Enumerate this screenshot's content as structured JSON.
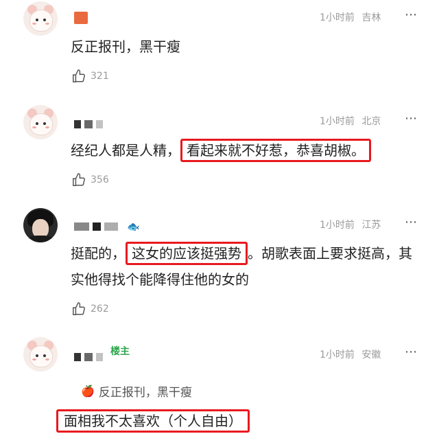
{
  "comments": [
    {
      "name_masked": "",
      "time": "1小时前",
      "location": "吉林",
      "text_pre": "反正报刊，黑干瘦",
      "text_hl": "",
      "text_post": "",
      "likes": "321",
      "avatar": "cute"
    },
    {
      "name_masked": "",
      "time": "1小时前",
      "location": "北京",
      "text_pre": "经纪人都是人精，",
      "text_hl": "看起来就不好惹，恭喜胡椒。",
      "text_post": "",
      "likes": "356",
      "avatar": "cute"
    },
    {
      "name_masked": "",
      "time": "1小时前",
      "location": "江苏",
      "text_pre": "挺配的，",
      "text_hl": "这女的应该挺强势",
      "text_post": "。胡歌表面上要求挺高，其实他得找个能降得住他的女的",
      "likes": "262",
      "avatar": "dark"
    },
    {
      "name_masked": "",
      "owner_badge": "楼主",
      "time": "1小时前",
      "location": "安徽",
      "quote": "反正报刊，黑干瘦",
      "text_hl": "面相我不太喜欢（个人自由）",
      "avatar": "cute"
    }
  ],
  "icons": {
    "more": "more-dots-icon",
    "like": "thumbs-up-icon",
    "apple": "apple-icon",
    "fish": "fish-icon"
  },
  "colors": {
    "highlight_border": "#e8191e",
    "owner_badge": "#2aa54a",
    "meta": "#9a9a9a"
  }
}
